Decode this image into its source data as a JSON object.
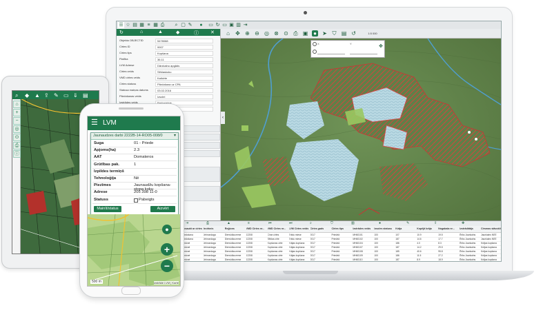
{
  "laptop": {
    "left_panel": {
      "attributes": [
        {
          "k": "Objekta OBJECTID",
          "v": "5478088"
        },
        {
          "k": "Cirtes ID",
          "v": "9907"
        },
        {
          "k": "Cirtes tips",
          "v": "Kopšana"
        },
        {
          "k": "Platība",
          "v": "36.11"
        },
        {
          "k": "LVM Adrese",
          "v": "Dārzkalnu apgāds"
        },
        {
          "k": "Cirtes veids",
          "v": "Sēklaskoku"
        },
        {
          "k": "VMD cirtes veids",
          "v": "Kailcirte"
        },
        {
          "k": "Cirtes statuss",
          "v": "Pārdošana uz CPA"
        },
        {
          "k": "Statusa maiņas datums",
          "v": "03.02.2016"
        },
        {
          "k": "Pārdošanas veids",
          "v": "Izsolei"
        },
        {
          "k": "Izstrādes veids",
          "v": "Pašizstrāde"
        },
        {
          "k": "Ģeometrijas statuss",
          "v": "GPS"
        }
      ]
    },
    "table": {
      "headers": [
        "Cirtes ID",
        "Objekts",
        "Nogabali ar cirtes...",
        "Nosaukt ar cirtes...",
        "Iecirknis",
        "Reģions",
        "VMD Cirtes nr...",
        "VMD Cirtes nr...",
        "LVM Cirtes veids",
        "Cirtes gads",
        "Cirtes tips",
        "Izstrādes veids",
        "Izsoles statuss",
        "Krāja",
        "Kopējā krāja",
        "Nogabala nr...",
        "Izstrādātājs",
        "Cirsmas stāvoklis"
      ],
      "rows": [
        [
          "Kurzemes",
          "Ūdeņu pagasts",
          "Pārdošana",
          "Jelmondaga",
          "Dienvidkurzeme",
          "12208",
          "Ciran cirtes",
          "Erkšu miese",
          "2017",
          "Primārā",
          "MH60101",
          "100",
          "107",
          "10.9",
          "19.5",
          "Ēriks Jaunkalns",
          "Jaunkalns NEE"
        ],
        [
          "Kurzemes",
          "Ūdeņu pagasts",
          "Pārdošana",
          "Jelmondaga",
          "Dienvidkurzeme",
          "12208",
          "Sēklas cirte",
          "Erkšu miese",
          "2017",
          "Primārā",
          "MH60102",
          "100",
          "187",
          "14.6",
          "17.7",
          "Ēriks Jaunkalns",
          "Jaunkalns NEE"
        ],
        [
          "Kurzemes",
          "Ūdeņu pagasts",
          "Sīrdonė",
          "Jelmondaga",
          "Dienvidkurzeme",
          "12208",
          "Kopšanas cirte",
          "Krājas kopšana",
          "2017",
          "Primārā",
          "MH60104",
          "100",
          "186",
          "4.0",
          "8.3",
          "Ēriks Jaunkalns",
          "Krājas kopšana"
        ],
        [
          "Kurzemes",
          "Ūdeņu pagasts",
          "Sīrdonė",
          "Jelmondaga",
          "Dienvidkurzeme",
          "12208",
          "Kopšanas cirte",
          "Krājas kopšana",
          "2017",
          "Primārā",
          "MH60107",
          "100",
          "187",
          "14.2",
          "29.5",
          "Ēriks Jaunkalns",
          "Krājas kopšana"
        ],
        [
          "Kurzemes",
          "Ūdeņu pagasts",
          "Sīrdonė",
          "Jelmondaga",
          "Dienvidkurzeme",
          "12208",
          "Kopšanas cirte",
          "Krājas kopšana",
          "2017",
          "Primārā",
          "MH60108",
          "100",
          "185",
          "40.6",
          "95.8",
          "Ēriks Jaunkalns",
          "Krājas kopšana"
        ],
        [
          "Kurzemes",
          "Ūdeņu pagasts",
          "Sīrdonė",
          "Jelmondaga",
          "Dienvidkurzeme",
          "12208",
          "Kopšanas cirte",
          "Krājas kopšana",
          "2017",
          "Primārā",
          "MH60109",
          "100",
          "186",
          "11.5",
          "27.2",
          "Ēriks Jaunkalns",
          "Krājas kopšana"
        ],
        [
          "Kurzemes",
          "Ūdeņu pagasts",
          "Sīrdonė",
          "Jelmondaga",
          "Dienvidkurzeme",
          "12208",
          "Kopšanas cirte",
          "Krājas kopšana",
          "2017",
          "Primārā",
          "MH60110",
          "100",
          "187",
          "8.9",
          "18.9",
          "Ēriks Jaunkalns",
          "Krājas kopšana"
        ]
      ]
    },
    "coords": {
      "x_label": "X",
      "y_label": "Y",
      "x_value": "",
      "y_value": ""
    }
  },
  "phone": {
    "title": "LVM",
    "popup_header": "Jaunaudzes darbi 2222B-14-RO05-008/0",
    "rows": [
      {
        "k": "Suga",
        "v": "01 - Priede"
      },
      {
        "k": "Apjoms(ha)",
        "v": "2.3"
      },
      {
        "k": "AAT",
        "v": "Domateros"
      },
      {
        "k": "Grūtības pak.",
        "v": "1"
      },
      {
        "k": "Izpildes termiņš",
        "v": ""
      },
      {
        "k": "Tehnoloģija",
        "v": "Nē"
      },
      {
        "k": "Piezīmes",
        "v": "Jaunaudžu kopšana-stopa koku"
      },
      {
        "k": "Adrese",
        "v": "205 398 11-0"
      },
      {
        "k": "Statuss",
        "v": "Pabeigts"
      }
    ],
    "btn_left": "Mainīt/status",
    "btn_right": "Aizvērt",
    "scale": "500 m",
    "attribution": "izstrāde LVM | Karte"
  },
  "colors": {
    "brand_green": "#1f7a4d",
    "forest": "#5f8048",
    "hatch_red": "#d0473c",
    "clearcut_blue": "#b9d9e3"
  }
}
